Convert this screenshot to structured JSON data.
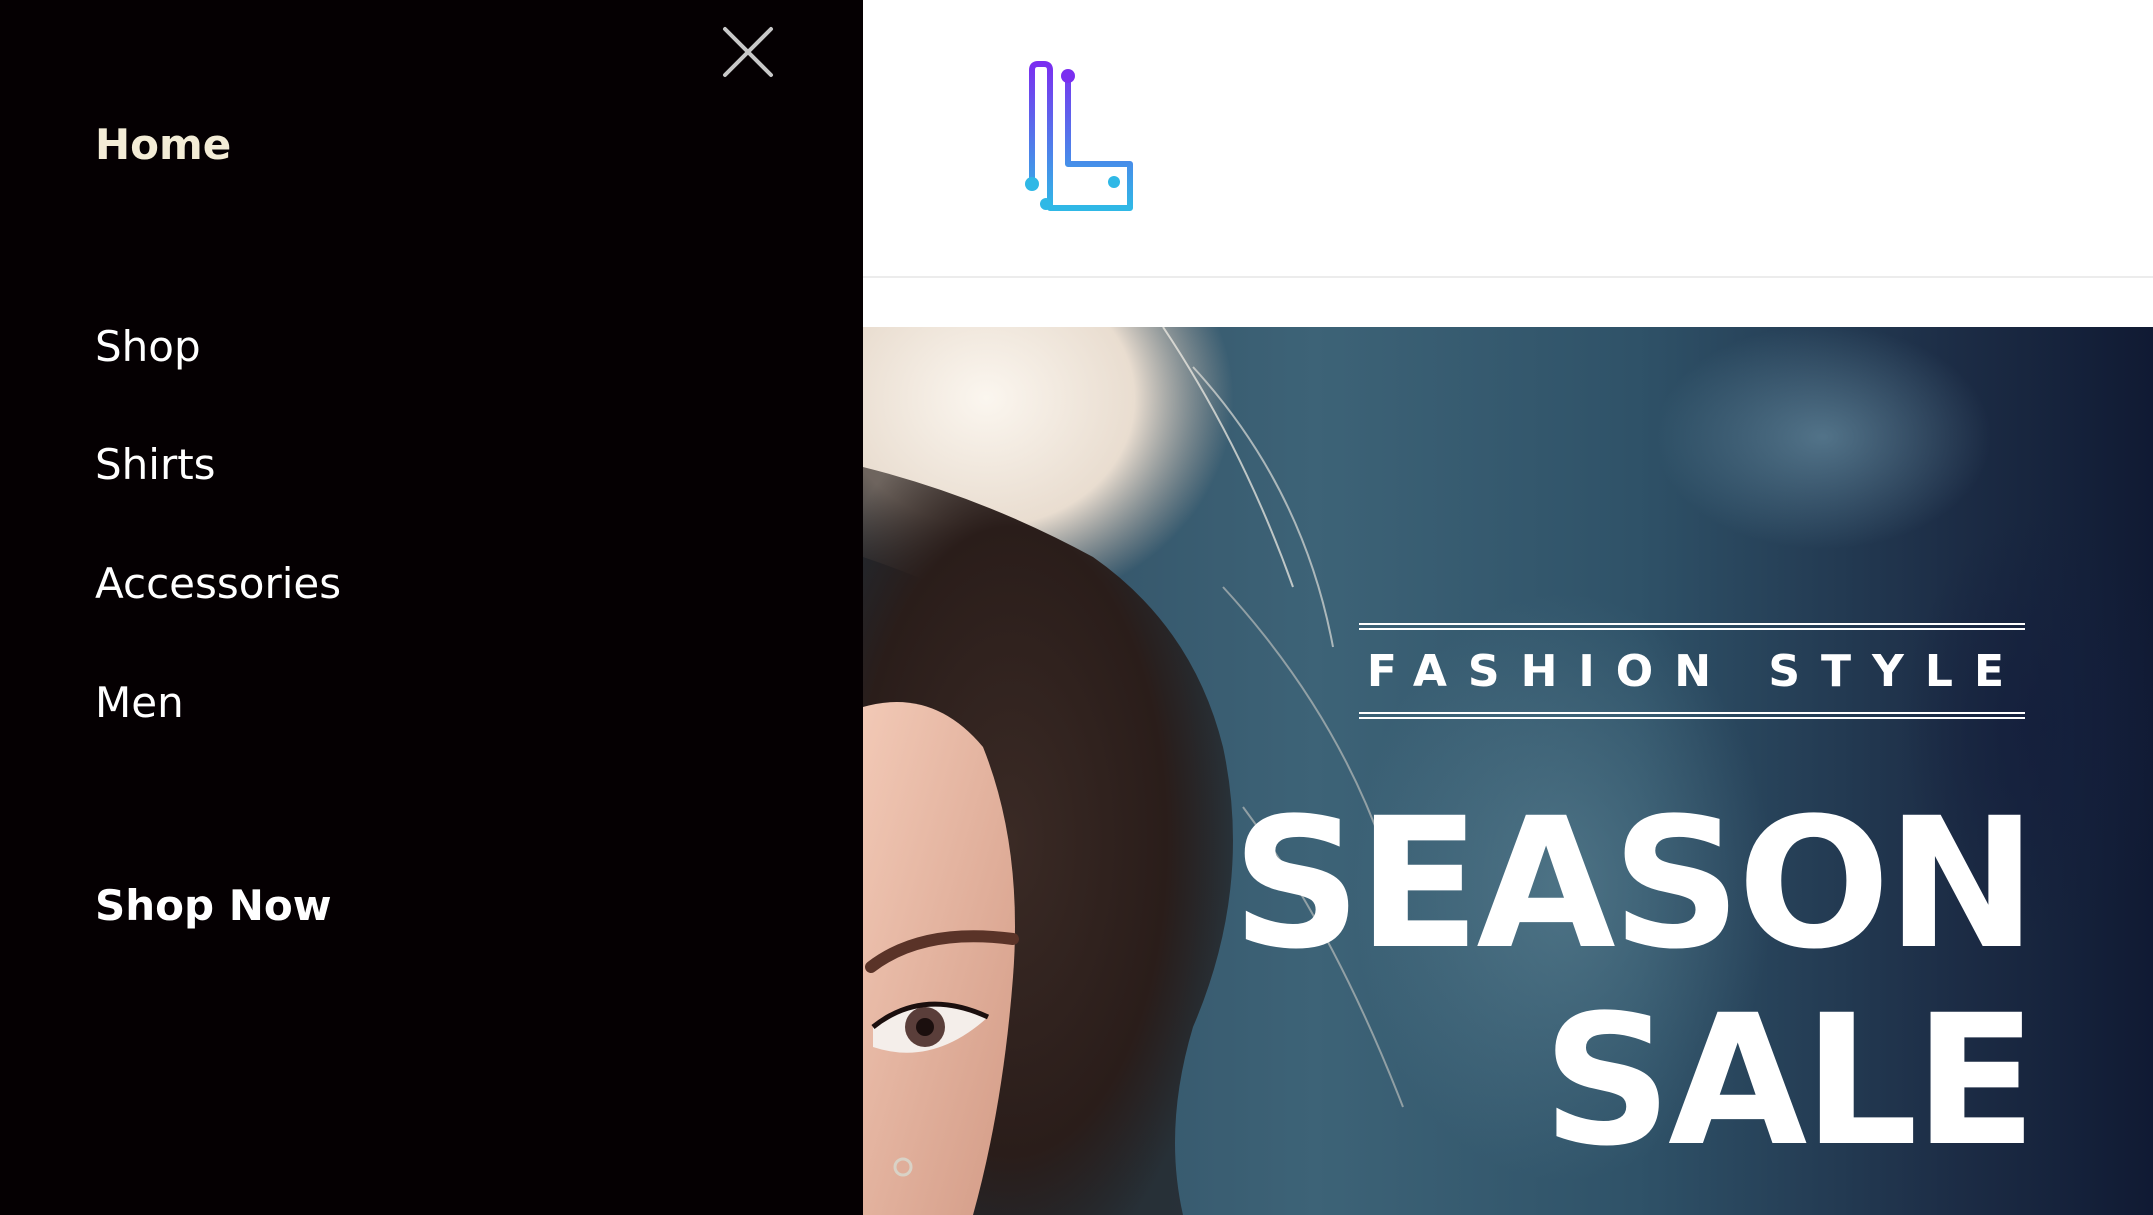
{
  "drawer": {
    "close_icon": "close-icon",
    "items": [
      {
        "label": "Home",
        "active": true
      },
      {
        "label": "Shop"
      },
      {
        "label": "Shirts"
      },
      {
        "label": "Accessories"
      },
      {
        "label": "Men"
      },
      {
        "label": "Shop Now"
      }
    ],
    "colors": {
      "background": "#050002",
      "active_text": "#f3ecd6",
      "text": "#ffffff"
    }
  },
  "header": {
    "logo_icon": "logo-icon",
    "logo_colors": [
      "#7a2ff0",
      "#2fb8e6"
    ]
  },
  "hero": {
    "tagline": "FASHION STYLE",
    "title_line1": "SEASON",
    "title_line2": "SALE"
  }
}
